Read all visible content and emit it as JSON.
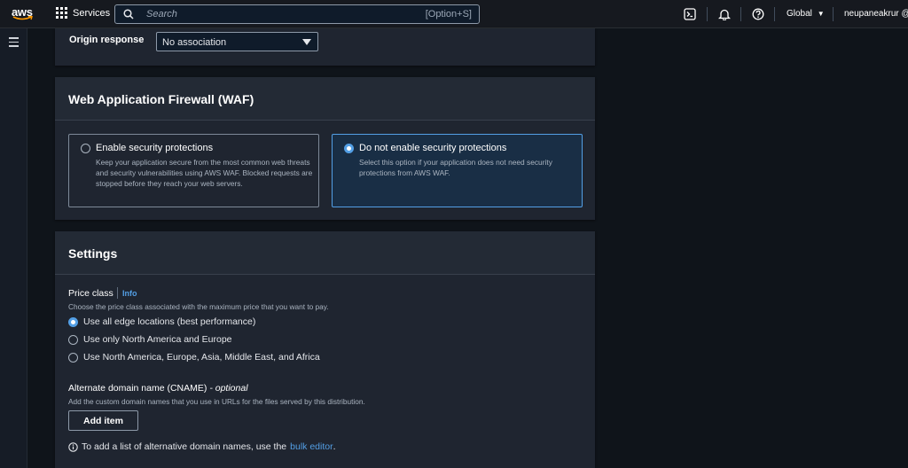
{
  "topnav": {
    "logo_text": "aws",
    "services_label": "Services",
    "search_placeholder": "Search",
    "search_shortcut": "[Option+S]",
    "region_label": "Global",
    "user_label": "neupaneakrur @"
  },
  "origin": {
    "label": "Origin response",
    "select_value": "No association"
  },
  "waf": {
    "title": "Web Application Firewall (WAF)",
    "options": [
      {
        "title": "Enable security protections",
        "desc": "Keep your application secure from the most common web threats and security vulnerabilities using AWS WAF. Blocked requests are stopped before they reach your web servers.",
        "selected": false
      },
      {
        "title": "Do not enable security protections",
        "desc": "Select this option if your application does not need security protections from AWS WAF.",
        "selected": true
      }
    ]
  },
  "settings": {
    "title": "Settings",
    "price_class_label": "Price class",
    "info_link": "Info",
    "price_class_hint": "Choose the price class associated with the maximum price that you want to pay.",
    "price_options": [
      {
        "label": "Use all edge locations (best performance)",
        "selected": true
      },
      {
        "label": "Use only North America and Europe",
        "selected": false
      },
      {
        "label": "Use North America, Europe, Asia, Middle East, and Africa",
        "selected": false
      }
    ],
    "cname_label": "Alternate domain name (CNAME)",
    "cname_optional": "- optional",
    "cname_hint": "Add the custom domain names that you use in URLs for the files served by this distribution.",
    "add_item_label": "Add item",
    "note_text": "To add a list of alternative domain names, use the",
    "note_link": "bulk editor",
    "note_end": "."
  },
  "colors": {
    "accent": "#539fe5",
    "background": "#0f141a",
    "panel": "#1f2530"
  }
}
